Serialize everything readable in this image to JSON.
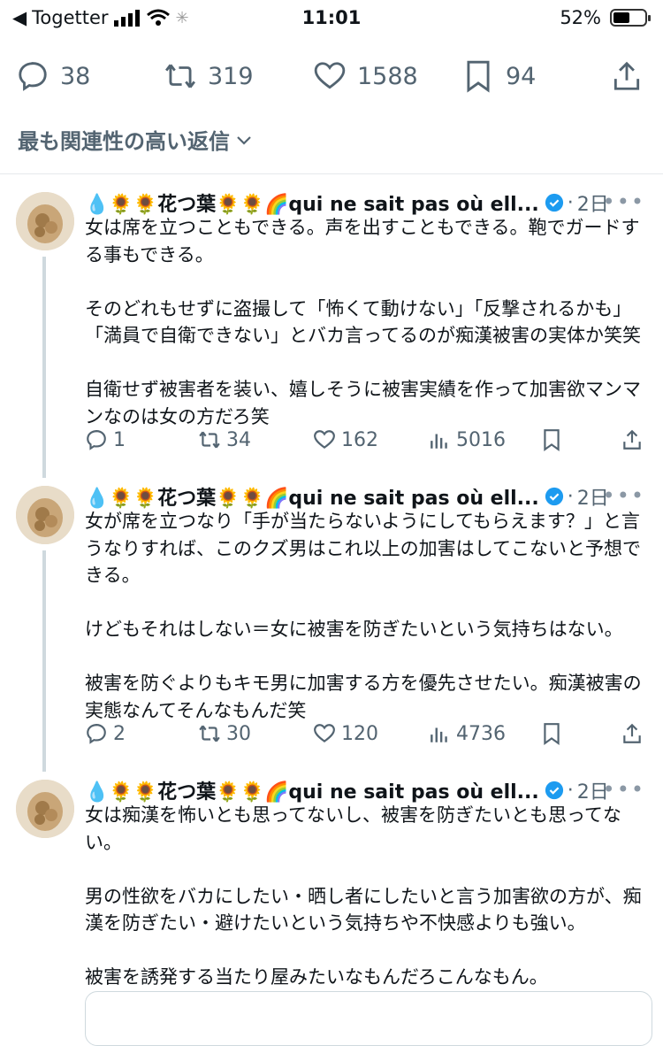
{
  "status_bar": {
    "back_app": "Togetter",
    "time": "11:01",
    "battery": "52%",
    "battery_level": 0.52
  },
  "tweet_actions": {
    "replies": "38",
    "retweets": "319",
    "likes": "1588",
    "bookmarks": "94"
  },
  "sort_label": "最も関連性の高い返信",
  "replies": [
    {
      "name": "💧🌻🌻花つ葉🌻🌻🌈qui ne sait pas où ell...",
      "time": "2日",
      "text": "女は席を立つこともできる。声を出すこともできる。鞄でガードする事もできる。\n\nそのどれもせずに盗撮して「怖くて動けない」「反撃されるかも」「満員で自衛できない」とバカ言ってるのが痴漢被害の実体か笑笑\n\n自衛せず被害者を装い、嬉しそうに被害実績を作って加害欲マンマンなのは女の方だろ笑",
      "replies": "1",
      "retweets": "34",
      "likes": "162",
      "views": "5016"
    },
    {
      "name": "💧🌻🌻花つ葉🌻🌻🌈qui ne sait pas où ell...",
      "time": "2日",
      "text": "女が席を立つなり「手が当たらないようにしてもらえます？」と言うなりすれば、このクズ男はこれ以上の加害はしてこないと予想できる。\n\nけどもそれはしない＝女に被害を防ぎたいという気持ちはない。\n\n被害を防ぐよりもキモ男に加害する方を優先させたい。痴漢被害の実態なんてそんなもんだ笑",
      "replies": "2",
      "retweets": "30",
      "likes": "120",
      "views": "4736"
    },
    {
      "name": "💧🌻🌻花つ葉🌻🌻🌈qui ne sait pas où ell...",
      "time": "2日",
      "text": "女は痴漢を怖いとも思ってないし、被害を防ぎたいとも思ってない。\n\n男の性欲をバカにしたい・晒し者にしたいと言う加害欲の方が、痴漢を防ぎたい・避けたいという気持ちや不快感よりも強い。\n\n被害を誘発する当たり屋みたいなもんだろこんなもん。"
    }
  ],
  "colors": {
    "text": "#0f1419",
    "muted": "#536471",
    "verified": "#1d9bf0",
    "thread_line": "#cfd9de"
  }
}
